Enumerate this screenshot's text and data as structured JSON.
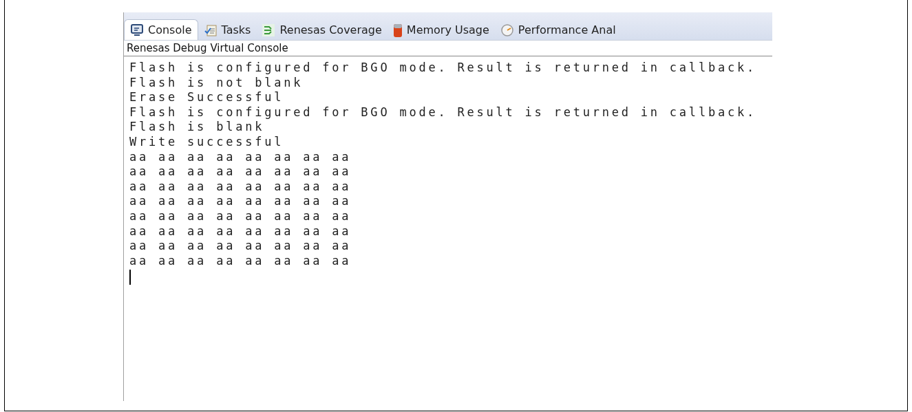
{
  "tabs": [
    {
      "label": "Console",
      "selected": true,
      "kind": "console"
    },
    {
      "label": "Tasks",
      "selected": false,
      "kind": "tasks"
    },
    {
      "label": "Renesas Coverage",
      "selected": false,
      "kind": "coverage"
    },
    {
      "label": "Memory Usage",
      "selected": false,
      "kind": "memory"
    },
    {
      "label": "Performance Anal",
      "selected": false,
      "kind": "performance"
    }
  ],
  "console": {
    "title": "Renesas Debug Virtual Console",
    "lines": [
      "Flash is configured for BGO mode. Result is returned in callback.",
      "Flash is not blank",
      "Erase Successful",
      "Flash is configured for BGO mode. Result is returned in callback.",
      "Flash is blank",
      "Write successful",
      "aa aa aa aa aa aa aa aa",
      "aa aa aa aa aa aa aa aa",
      "aa aa aa aa aa aa aa aa",
      "aa aa aa aa aa aa aa aa",
      "aa aa aa aa aa aa aa aa",
      "aa aa aa aa aa aa aa aa",
      "aa aa aa aa aa aa aa aa",
      "aa aa aa aa aa aa aa aa"
    ]
  }
}
